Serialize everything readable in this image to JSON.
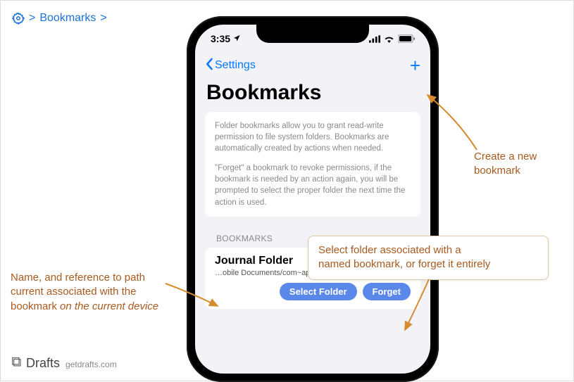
{
  "breadcrumb": {
    "label": "Bookmarks"
  },
  "footer": {
    "brand": "Drafts",
    "url": "getdrafts.com"
  },
  "phone": {
    "status": {
      "time": "3:35"
    },
    "nav": {
      "back_label": "Settings"
    },
    "title": "Bookmarks",
    "info": {
      "p1": "Folder bookmarks allow you to grant read-write permission to file system folders. Bookmarks are automatically created by actions when needed.",
      "p2": "\"Forget\" a bookmark to revoke permissions, if the bookmark is needed by an action again, you will be prompted to select the proper folder the next time the action is used."
    },
    "section_header": "BOOKMARKS",
    "item": {
      "name": "Journal Folder",
      "path": "…obile Documents/com~apple~CloudDocs/TEMP_Do…",
      "select_label": "Select Folder",
      "forget_label": "Forget"
    }
  },
  "callouts": {
    "create": "Create a new\nbookmark",
    "select": "Select folder associated with a\nnamed bookmark, or forget it entirely",
    "name_p1": "Name, and reference to path current associated with the bookmark ",
    "name_p2": "on the current device"
  }
}
